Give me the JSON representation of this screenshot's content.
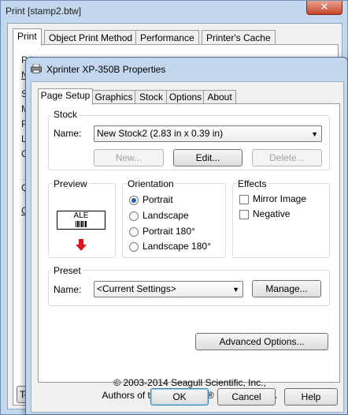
{
  "background_window": {
    "title": "Print [stamp2.btw]",
    "close_label": "✕",
    "tabs": [
      "Print",
      "Object Print Method",
      "Performance",
      "Printer's Cache"
    ],
    "fragments": [
      "Printer",
      "N",
      "S",
      "M",
      "P",
      "L",
      "C",
      "Q",
      "C",
      "Te"
    ]
  },
  "dialog": {
    "title": "Xprinter XP-350B Properties",
    "tabs": [
      "Page Setup",
      "Graphics",
      "Stock",
      "Options",
      "About"
    ],
    "stock": {
      "group_label": "Stock",
      "name_label": "Name:",
      "selected": "New Stock2 (2.83 in x 0.39 in)",
      "new_button": "New...",
      "edit_button": "Edit...",
      "delete_button": "Delete..."
    },
    "preview": {
      "group_label": "Preview",
      "label_text": "ALE"
    },
    "orientation": {
      "group_label": "Orientation",
      "options": [
        "Portrait",
        "Landscape",
        "Portrait 180°",
        "Landscape 180°"
      ],
      "selected": "Portrait"
    },
    "effects": {
      "group_label": "Effects",
      "options": [
        "Mirror Image",
        "Negative"
      ]
    },
    "preset": {
      "group_label": "Preset",
      "name_label": "Name:",
      "selected": "<Current Settings>",
      "manage_button": "Manage..."
    },
    "advanced_button": "Advanced Options...",
    "copyright_line1": "© 2003-2014 Seagull Scientific, Inc.,",
    "copyright_line2": "Authors of the BarTender® label software.",
    "ok_button": "OK",
    "cancel_button": "Cancel",
    "help_button": "Help"
  },
  "colors": {
    "window_frame": "#c2d6ed",
    "radio_selected": "#1e5fae",
    "arrow_red": "#d9141a"
  }
}
